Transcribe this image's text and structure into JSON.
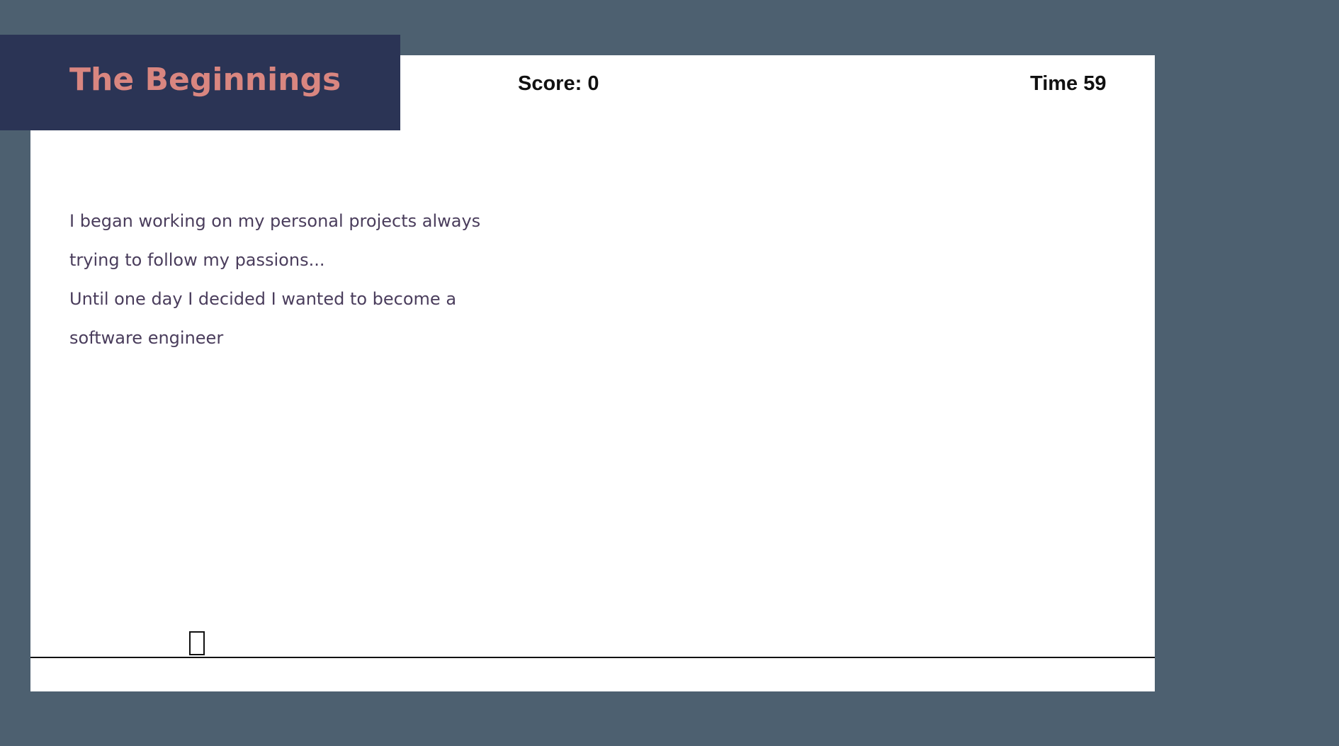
{
  "level": {
    "title": "The Beginnings"
  },
  "hud": {
    "score_text": "Score: 0",
    "time_text": "Time 59"
  },
  "story": {
    "lines": [
      "I began working on my personal projects always",
      "trying to follow my passions...",
      "Until one day I decided I wanted to become a",
      "software engineer"
    ]
  },
  "colors": {
    "background": "#4d6070",
    "banner": "#2b3455",
    "title": "#d98680",
    "story_text": "#4a3d5c"
  }
}
